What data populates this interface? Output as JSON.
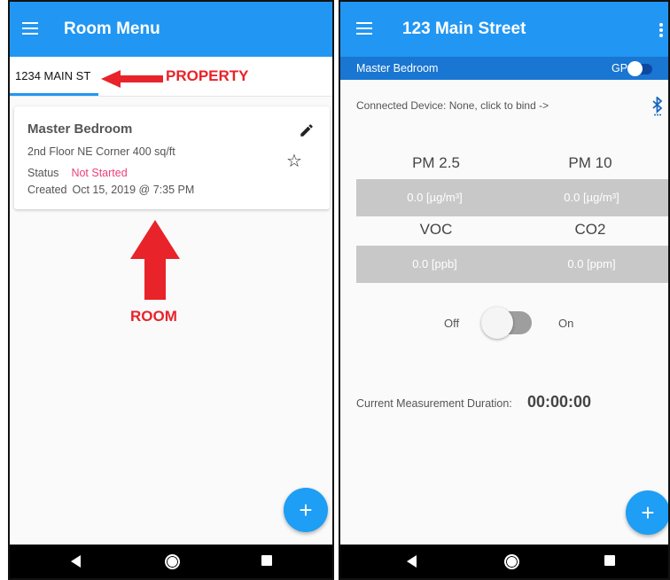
{
  "left_screen": {
    "title": "Room Menu",
    "tab": "1234 MAIN ST",
    "annotation_property": "PROPERTY",
    "annotation_room": "ROOM",
    "card": {
      "name": "Master Bedroom",
      "description": "2nd Floor NE Corner 400 sq/ft",
      "status_label": "Status",
      "status_value": "Not Started",
      "created_label": "Created",
      "created_value": "Oct 15, 2019 @ 7:35 PM"
    },
    "fab_label": "+"
  },
  "right_screen": {
    "title": "123 Main Street",
    "room": "Master Bedroom",
    "gps_label": "GPS",
    "connected_device": "Connected Device:  None, click to bind ->",
    "metrics": [
      {
        "name": "PM 2.5",
        "value": "0.0 [µg/m³]"
      },
      {
        "name": "PM 10",
        "value": "0.0 [µg/m³]"
      },
      {
        "name": "VOC",
        "value": "0.0 [ppb]"
      },
      {
        "name": "CO2",
        "value": "0.0 [ppm]"
      }
    ],
    "toggle_off": "Off",
    "toggle_on": "On",
    "duration_label": "Current Measurement Duration:",
    "duration_value": "00:00:00",
    "fab_label": "+"
  },
  "colors": {
    "appbar": "#2196f3",
    "subbar": "#1976d2",
    "accent_pink": "#ec407a",
    "annotation_red": "#e8232a",
    "metric_box": "#c8c8c8",
    "bluetooth": "#1565c0"
  },
  "icons": [
    "menu-icon",
    "edit-icon",
    "star-outline-icon",
    "bluetooth-searching-icon",
    "more-vert-icon",
    "back-icon",
    "home-icon",
    "recents-icon"
  ]
}
